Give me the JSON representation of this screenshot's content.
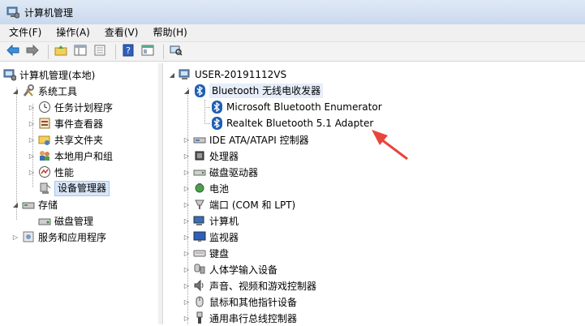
{
  "window": {
    "title": "计算机管理"
  },
  "menu": [
    "文件(F)",
    "操作(A)",
    "查看(V)",
    "帮助(H)"
  ],
  "toolbar": [
    "back-icon",
    "forward-icon",
    "up-folder-icon",
    "show-tree-icon",
    "export-icon",
    "help-icon",
    "properties-icon",
    "scan-hardware-icon"
  ],
  "left_tree": [
    {
      "label": "计算机管理(本地)",
      "icon": "computer-management-icon"
    },
    {
      "label": "系统工具",
      "icon": "system-tools-icon"
    },
    {
      "label": "任务计划程序",
      "icon": "clock-icon"
    },
    {
      "label": "事件查看器",
      "icon": "event-viewer-icon"
    },
    {
      "label": "共享文件夹",
      "icon": "shared-folder-icon"
    },
    {
      "label": "本地用户和组",
      "icon": "users-icon"
    },
    {
      "label": "性能",
      "icon": "performance-icon"
    },
    {
      "label": "设备管理器",
      "icon": "device-manager-icon"
    },
    {
      "label": "存储",
      "icon": "storage-icon"
    },
    {
      "label": "磁盘管理",
      "icon": "disk-icon"
    },
    {
      "label": "服务和应用程序",
      "icon": "services-icon"
    }
  ],
  "right_tree": {
    "root": "USER-20191112VS",
    "bluetooth": "Bluetooth 无线电收发器",
    "bt_children": [
      "Microsoft Bluetooth Enumerator",
      "Realtek Bluetooth 5.1 Adapter"
    ],
    "categories": [
      "IDE ATA/ATAPI 控制器",
      "处理器",
      "磁盘驱动器",
      "电池",
      "端口 (COM 和 LPT)",
      "计算机",
      "监视器",
      "键盘",
      "人体学输入设备",
      "声音、视频和游戏控制器",
      "鼠标和其他指针设备",
      "通用串行总线控制器"
    ]
  },
  "colors": {
    "annotation_arrow": "#e8453c",
    "bluetooth": "#1d5fb3",
    "selection": "#d8e6f7"
  }
}
